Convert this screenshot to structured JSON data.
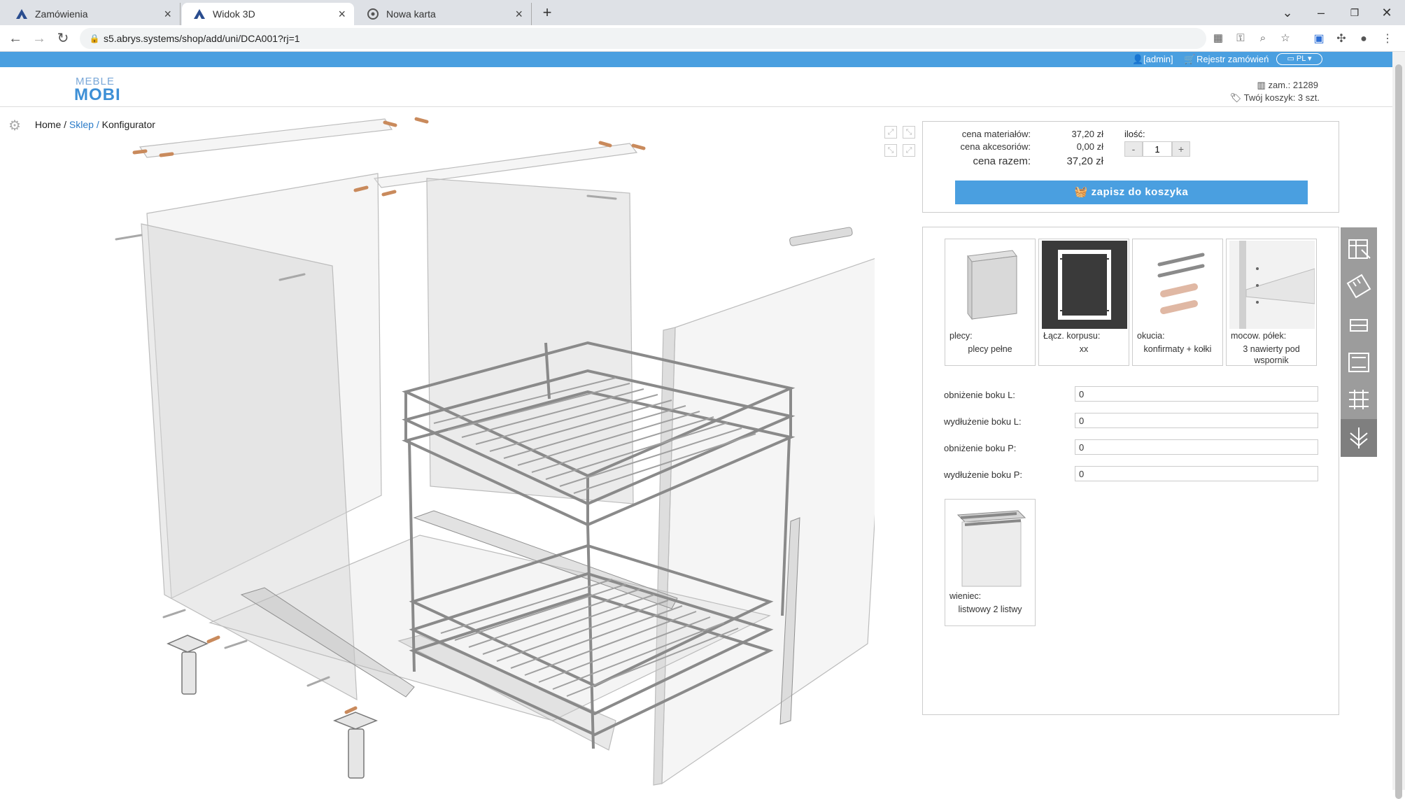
{
  "browser": {
    "tabs": [
      {
        "title": "Zamówienia",
        "icon": "abrys-logo-icon"
      },
      {
        "title": "Widok 3D",
        "icon": "abrys-logo-icon",
        "active": true
      },
      {
        "title": "Nowa karta",
        "icon": "chrome-icon"
      }
    ],
    "new_tab_symbol": "+",
    "url": "s5.abrys.systems/shop/add/uni/DCA001?rj=1"
  },
  "site": {
    "user": "[admin]",
    "orders_register": "Rejestr zamówień",
    "language": "PL",
    "logo_top": "MEBLE",
    "logo_bottom": "MOBI",
    "order_number": "zam.: 21289",
    "cart": "Twój koszyk: 3 szt."
  },
  "breadcrumb": {
    "home": "Home",
    "shop": "Sklep",
    "current": "Konfigurator",
    "separator": "/"
  },
  "price": {
    "materials_label": "cena materiałów:",
    "materials_value": "37,20 zł",
    "accessories_label": "cena akcesoriów:",
    "accessories_value": "0,00 zł",
    "total_label": "cena razem:",
    "total_value": "37,20 zł",
    "qty_label": "ilość:",
    "qty_value": "1",
    "minus": "-",
    "plus": "+",
    "add_to_cart": "zapisz do koszyka"
  },
  "options": [
    {
      "label": "plecy:",
      "value": "plecy pełne",
      "icon": "cabinet-back-panel-icon"
    },
    {
      "label": "Łącz. korpusu:",
      "value": "xx",
      "icon": "body-joint-frame-icon",
      "selected": true
    },
    {
      "label": "okucia:",
      "value": "konfirmaty + kołki",
      "icon": "screws-dowels-icon"
    },
    {
      "label": "mocow. półek:",
      "value": "3 nawierty pod wspornik",
      "icon": "shelf-mounting-icon"
    }
  ],
  "fields": [
    {
      "label": "obniżenie boku L:",
      "value": "0"
    },
    {
      "label": "wydłużenie boku L:",
      "value": "0"
    },
    {
      "label": "obniżenie boku P:",
      "value": "0"
    },
    {
      "label": "wydłużenie boku P:",
      "value": "0"
    }
  ],
  "crown": {
    "label": "wieniec:",
    "value": "listwowy 2 listwy",
    "icon": "crown-rails-icon"
  },
  "colors": {
    "accent": "#4a9fe0",
    "tab_strip": "#dee1e6",
    "side_tools": "#9c9c9c",
    "selected_card": "#3a3a3a"
  }
}
